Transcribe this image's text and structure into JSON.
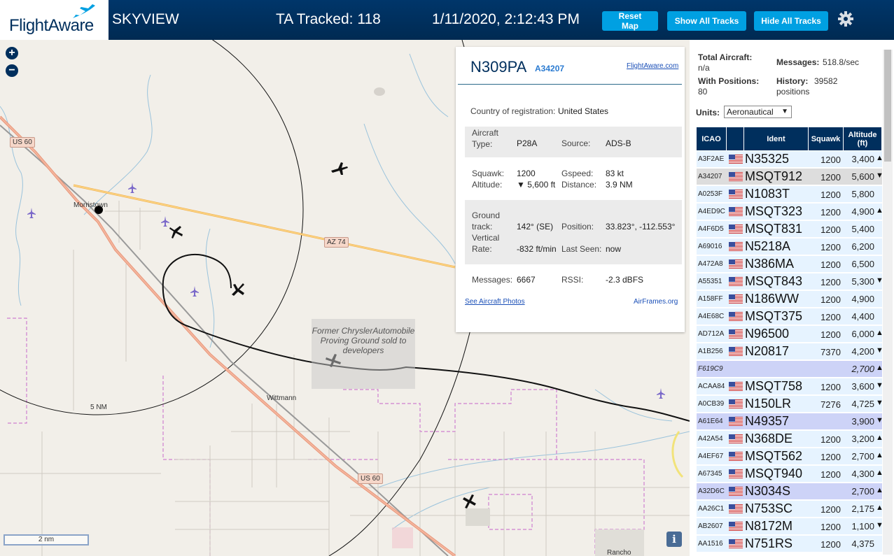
{
  "header": {
    "logo": "FlightAware",
    "app_name": "SKYVIEW",
    "tracked": "TA Tracked: 118",
    "datetime": "1/11/2020, 2:12:43 PM",
    "reset_label": "Reset Map",
    "show_tracks_label": "Show All Tracks",
    "hide_tracks_label": "Hide All Tracks"
  },
  "map": {
    "zoom_in": "+",
    "zoom_out": "−",
    "scale": "2 nm",
    "range_ring": "5 NM",
    "places": [
      "Morristown",
      "Wittmann"
    ],
    "road_us60_a": "US 60",
    "road_az74": "AZ 74",
    "road_us60_b": "US 60",
    "proving_ground": "Former ChryslerAutomobile Proving Ground sold to developers",
    "rancho": "Rancho",
    "info": "i"
  },
  "popup": {
    "callsign": "N309PA",
    "hex": "A34207",
    "fa_link": "FlightAware.com",
    "country_label": "Country of registration:",
    "country": "United States",
    "aircraft_type_label": "Aircraft Type:",
    "aircraft_type": "P28A",
    "source_label": "Source:",
    "source": "ADS-B",
    "squawk_label": "Squawk:",
    "squawk": "1200",
    "gspeed_label": "Gspeed:",
    "gspeed": "83 kt",
    "altitude_label": "Altitude:",
    "altitude": "▼ 5,600 ft",
    "distance_label": "Distance:",
    "distance": "3.9 NM",
    "ground_track_label": "Ground track:",
    "ground_track": "142° (SE)",
    "position_label": "Position:",
    "position": "33.823°, -112.553°",
    "vertical_rate_label": "Vertical Rate:",
    "vertical_rate": "-832 ft/min",
    "last_seen_label": "Last Seen:",
    "last_seen": "now",
    "messages_label": "Messages:",
    "messages": "6667",
    "rssi_label": "RSSI:",
    "rssi": "-2.3 dBFS",
    "photos_link": "See Aircraft Photos",
    "airframes_link": "AirFrames.org"
  },
  "panel": {
    "total_label": "Total Aircraft:",
    "total": "n/a",
    "messages_label": "Messages:",
    "messages": "518.8/sec",
    "positions_label": "With Positions:",
    "positions": "80",
    "history_label": "History:",
    "history": "39582 positions",
    "units_label": "Units:",
    "units": "Aeronautical",
    "columns": [
      "ICAO",
      "",
      "Ident",
      "Squawk",
      "Altitude (ft)"
    ],
    "rows": [
      {
        "icao": "A3F2AE",
        "ident": "N35325",
        "squawk": "1200",
        "alt": "3,400",
        "arrow": "▲",
        "state": "normal"
      },
      {
        "icao": "A34207",
        "ident": "MSQT912",
        "squawk": "1200",
        "alt": "5,600",
        "arrow": "▼",
        "state": "sel"
      },
      {
        "icao": "A0253F",
        "ident": "N1083T",
        "squawk": "1200",
        "alt": "5,800",
        "arrow": "",
        "state": "normal"
      },
      {
        "icao": "A4ED9C",
        "ident": "MSQT323",
        "squawk": "1200",
        "alt": "4,900",
        "arrow": "▲",
        "state": "normal"
      },
      {
        "icao": "A4F6D5",
        "ident": "MSQT831",
        "squawk": "1200",
        "alt": "5,400",
        "arrow": "",
        "state": "normal"
      },
      {
        "icao": "A69016",
        "ident": "N5218A",
        "squawk": "1200",
        "alt": "6,200",
        "arrow": "",
        "state": "normal"
      },
      {
        "icao": "A472A8",
        "ident": "N386MA",
        "squawk": "1200",
        "alt": "6,500",
        "arrow": "",
        "state": "normal"
      },
      {
        "icao": "A55351",
        "ident": "MSQT843",
        "squawk": "1200",
        "alt": "5,300",
        "arrow": "▼",
        "state": "normal"
      },
      {
        "icao": "A158FF",
        "ident": "N186WW",
        "squawk": "1200",
        "alt": "4,900",
        "arrow": "",
        "state": "normal"
      },
      {
        "icao": "A4E68C",
        "ident": "MSQT375",
        "squawk": "1200",
        "alt": "4,400",
        "arrow": "",
        "state": "normal"
      },
      {
        "icao": "AD712A",
        "ident": "N96500",
        "squawk": "1200",
        "alt": "6,000",
        "arrow": "▲",
        "state": "normal"
      },
      {
        "icao": "A1B256",
        "ident": "N20817",
        "squawk": "7370",
        "alt": "4,200",
        "arrow": "▼",
        "state": "normal"
      },
      {
        "icao": "F619C9",
        "ident": "",
        "squawk": "",
        "alt": "2,700",
        "arrow": "▲",
        "state": "noloc"
      },
      {
        "icao": "ACAA84",
        "ident": "MSQT758",
        "squawk": "1200",
        "alt": "3,600",
        "arrow": "▼",
        "state": "normal"
      },
      {
        "icao": "A0CB39",
        "ident": "N150LR",
        "squawk": "7276",
        "alt": "4,725",
        "arrow": "▼",
        "state": "normal"
      },
      {
        "icao": "A61E64",
        "ident": "N49357",
        "squawk": "",
        "alt": "3,900",
        "arrow": "▼",
        "state": "noloc"
      },
      {
        "icao": "A42A54",
        "ident": "N368DE",
        "squawk": "1200",
        "alt": "3,200",
        "arrow": "▲",
        "state": "normal"
      },
      {
        "icao": "A4EF67",
        "ident": "MSQT562",
        "squawk": "1200",
        "alt": "2,700",
        "arrow": "▲",
        "state": "normal"
      },
      {
        "icao": "A67345",
        "ident": "MSQT940",
        "squawk": "1200",
        "alt": "4,300",
        "arrow": "▲",
        "state": "normal"
      },
      {
        "icao": "A32D6C",
        "ident": "N3034S",
        "squawk": "",
        "alt": "2,700",
        "arrow": "▲",
        "state": "noloc"
      },
      {
        "icao": "AA26C1",
        "ident": "N753SC",
        "squawk": "1200",
        "alt": "2,175",
        "arrow": "▲",
        "state": "normal"
      },
      {
        "icao": "AB2607",
        "ident": "N8172M",
        "squawk": "1200",
        "alt": "1,100",
        "arrow": "▼",
        "state": "normal"
      },
      {
        "icao": "AA1516",
        "ident": "N751RS",
        "squawk": "1200",
        "alt": "4,375",
        "arrow": "",
        "state": "normal"
      }
    ]
  },
  "colors": {
    "header_bg": "#002f5d",
    "button": "#00a0e2",
    "row_bg": "#e6f3ff",
    "row_selected": "#dddddd",
    "row_no_position": "#cdd3f7"
  }
}
